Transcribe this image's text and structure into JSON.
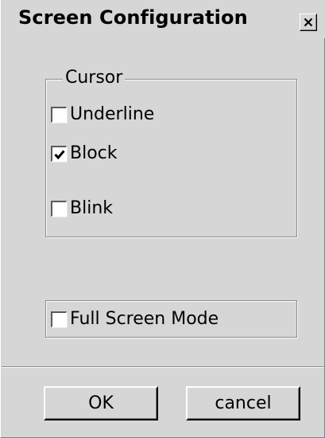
{
  "window": {
    "title": "Screen Configuration",
    "close_icon": "close-x-icon"
  },
  "cursor_group": {
    "legend": "Cursor",
    "options": [
      {
        "label": "Underline",
        "checked": false
      },
      {
        "label": "Block",
        "checked": true
      },
      {
        "label": "Blink",
        "checked": false
      }
    ]
  },
  "mode_group": {
    "option": {
      "label": "Full Screen Mode",
      "checked": false
    }
  },
  "buttons": {
    "ok_label": "OK",
    "cancel_label": "cancel"
  },
  "colors": {
    "background": "#d6d6d6",
    "checkbox_fill": "#ffffff",
    "text": "#000000"
  }
}
